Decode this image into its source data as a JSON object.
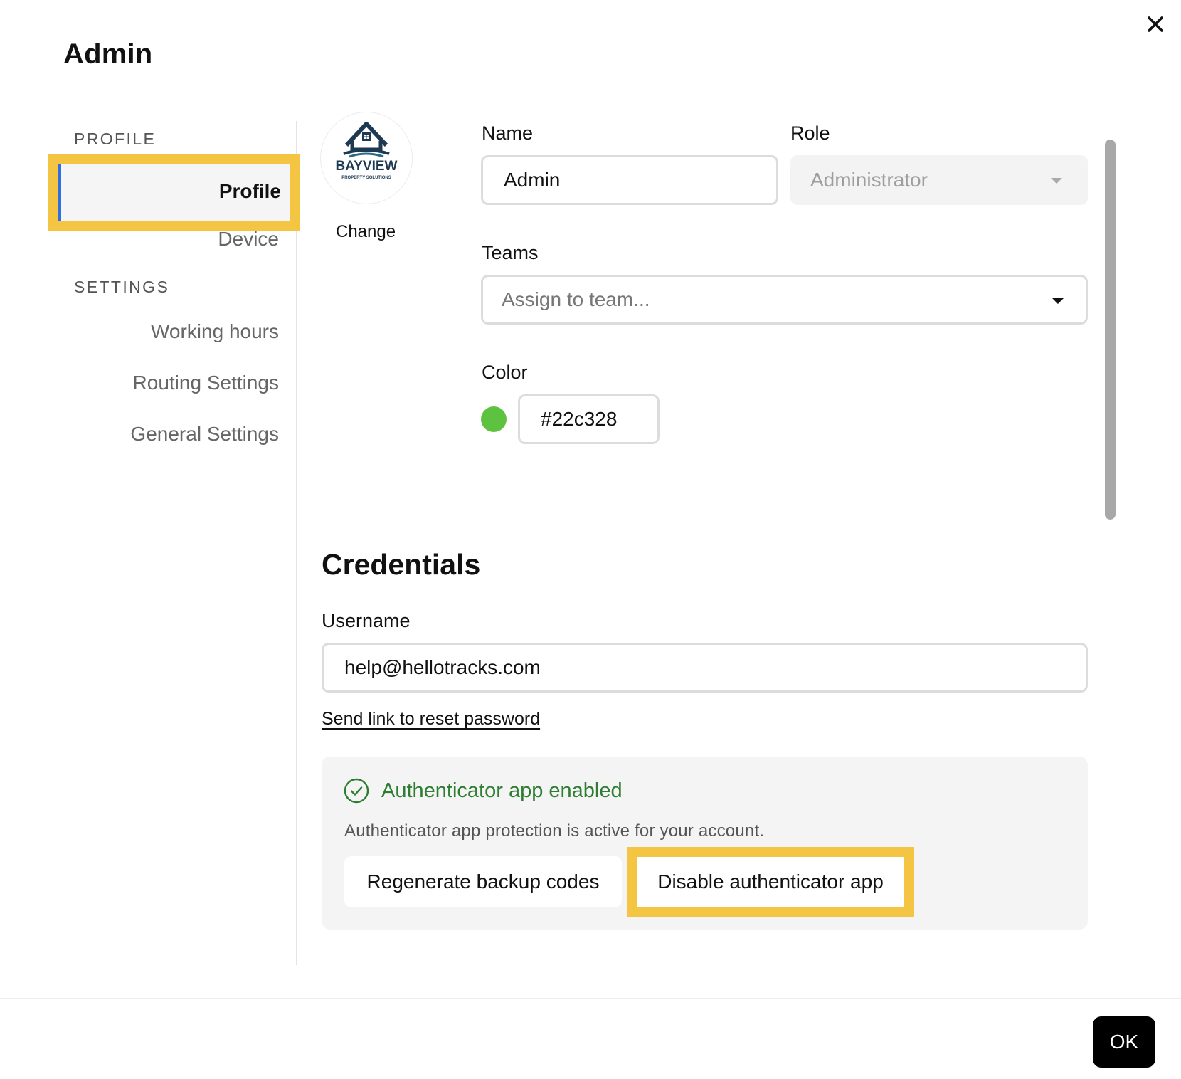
{
  "window": {
    "title": "Admin"
  },
  "sidebar": {
    "profile_heading": "PROFILE",
    "profile_items": [
      "Profile",
      "Device"
    ],
    "settings_heading": "SETTINGS",
    "settings_items": [
      "Working hours",
      "Routing Settings",
      "General Settings"
    ],
    "active_item": "Profile"
  },
  "avatar": {
    "logo_text": "BAYVIEW",
    "logo_subtext": "PROPERTY SOLUTIONS",
    "change_label": "Change"
  },
  "form": {
    "name_label": "Name",
    "name_value": "Admin",
    "role_label": "Role",
    "role_value": "Administrator",
    "teams_label": "Teams",
    "teams_placeholder": "Assign to team...",
    "color_label": "Color",
    "color_value": "#22c328",
    "color_swatch": "#5dc23f"
  },
  "credentials": {
    "heading": "Credentials",
    "username_label": "Username",
    "username_value": "help@hellotracks.com",
    "reset_link": "Send link to reset password"
  },
  "authenticator": {
    "status_title": "Authenticator app enabled",
    "status_description": "Authenticator app protection is active for your account.",
    "regenerate_label": "Regenerate backup codes",
    "disable_label": "Disable authenticator app",
    "status_color": "#2e7d32"
  },
  "footer": {
    "ok_label": "OK"
  },
  "colors": {
    "highlight": "#f4c542",
    "active_indicator": "#2f6fdf"
  }
}
